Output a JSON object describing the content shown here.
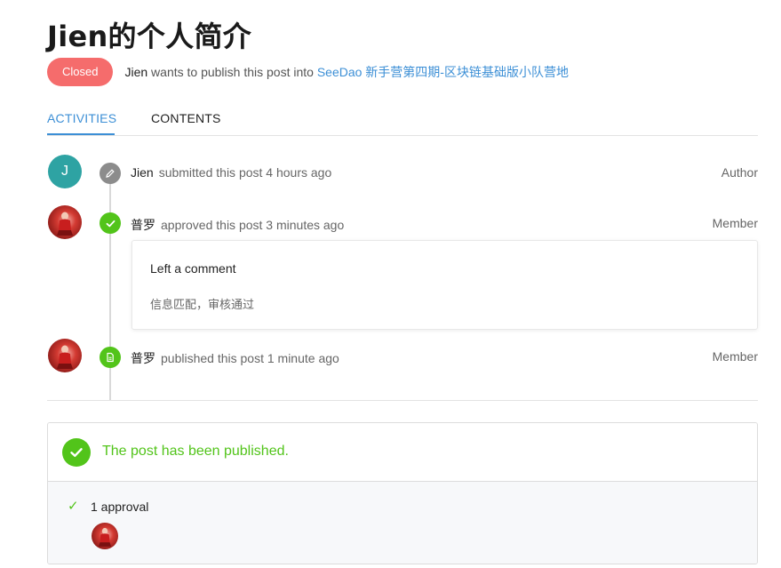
{
  "page": {
    "title": "Jien的个人简介"
  },
  "meta": {
    "status_badge": "Closed",
    "author": "Jien",
    "action_text": " wants to publish this post into ",
    "target_link": "SeeDao 新手营第四期-区块链基础版小队营地"
  },
  "tabs": [
    {
      "label": "ACTIVITIES",
      "active": true
    },
    {
      "label": "CONTENTS",
      "active": false
    }
  ],
  "activities": [
    {
      "avatar_letter": "J",
      "user": "Jien",
      "text": "submitted this post 4 hours ago",
      "role": "Author",
      "icon": "pencil-icon"
    },
    {
      "user": "普罗",
      "text": "approved this post 3 minutes ago",
      "role": "Member",
      "icon": "check-icon"
    },
    {
      "user": "普罗",
      "text": "published this post 1 minute ago",
      "role": "Member",
      "icon": "document-icon"
    }
  ],
  "comment": {
    "title": "Left a comment",
    "body": "信息匹配，审核通过"
  },
  "status": {
    "message": "The post has been published.",
    "approvals": "1 approval"
  },
  "colors": {
    "accent": "#3c8fd6",
    "success": "#52c41a",
    "closed": "#f56c6c",
    "avatar_teal": "#2ea3a3"
  }
}
